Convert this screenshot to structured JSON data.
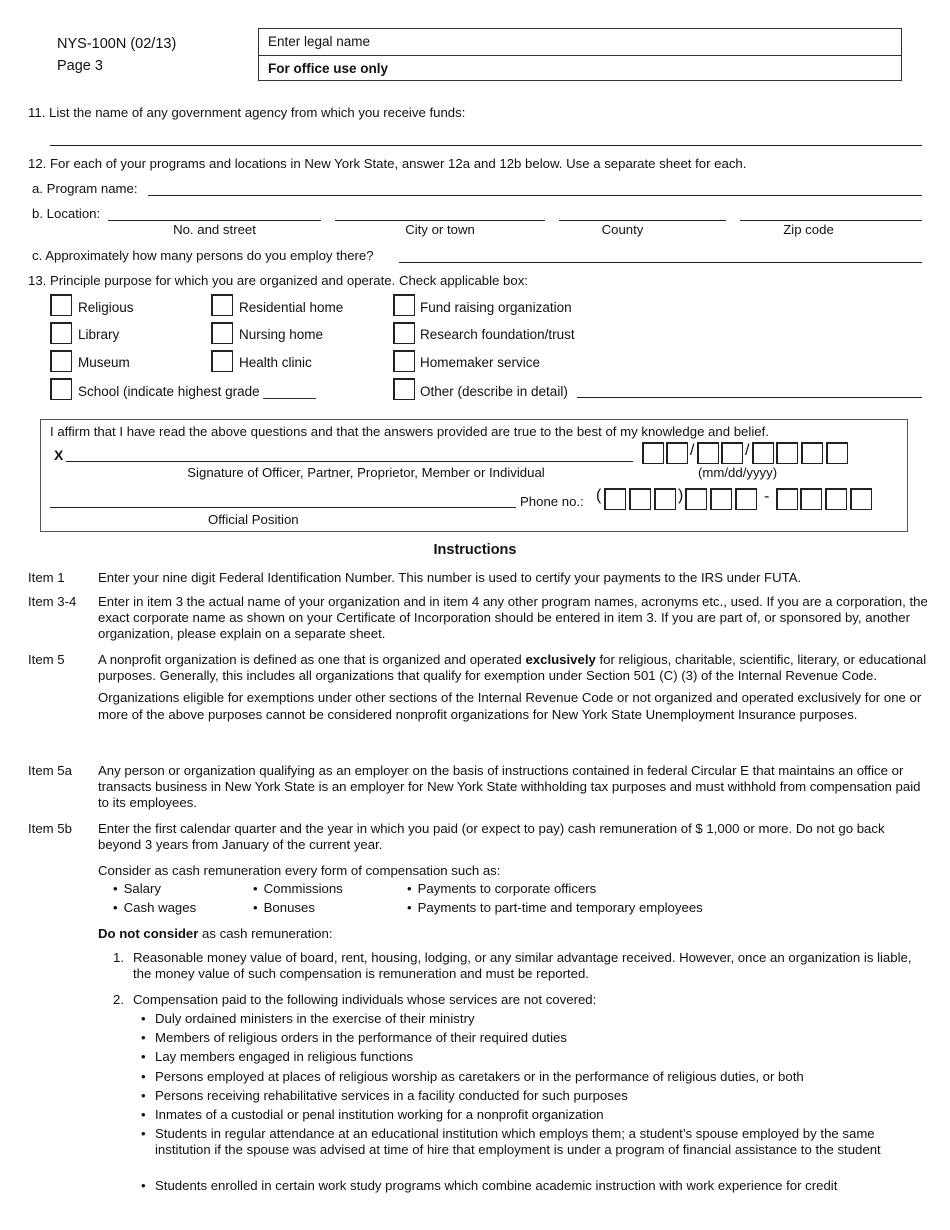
{
  "header": {
    "form_id": "NYS-100N (02/13)",
    "page": "Page 3",
    "legal_name_placeholder": "Enter legal name",
    "office_use": "For office use only"
  },
  "q11": {
    "label": "11. List the name of any government agency from which you receive funds:"
  },
  "q12": {
    "label": "12. For each of your programs and locations in New York State, answer 12a and 12b below.  Use a separate sheet for each.",
    "a_label": "a. Program name:",
    "b_label": "b. Location:",
    "location_fields": [
      "No. and street",
      "City or town",
      "County",
      "Zip code"
    ],
    "c_label": "c. Approximately how many persons do you employ there?"
  },
  "q13": {
    "label": "13. Principle purpose for which you are organized and operate.  Check applicable box:",
    "options": [
      "Religious",
      "Residential home",
      "Fund raising organization",
      "Library",
      "Nursing home",
      "Research foundation/trust",
      "Museum",
      "Health clinic",
      "Homemaker service",
      "School (indicate highest grade _______",
      "Other (describe in detail)"
    ]
  },
  "affirm": {
    "statement": "I affirm that I have read the above questions and that the answers provided are true to the best of my knowledge and belief.",
    "x_mark": "X",
    "signature_caption": "Signature of Officer, Partner, Proprietor, Member or Individual",
    "date_caption": "(mm/dd/yyyy)",
    "date_sep": "/",
    "phone_label": "Phone no.:",
    "phone_open": "(",
    "phone_close": ")",
    "phone_dash": "-",
    "position_caption": "Official Position"
  },
  "instructions": {
    "title": "Instructions",
    "items": [
      {
        "label": "Item 1",
        "paras": [
          "Enter your nine digit Federal Identification Number.  This number is used to certify your payments to the IRS under FUTA."
        ]
      },
      {
        "label": "Item 3-4",
        "paras": [
          "Enter in item 3 the actual name of your organization and in item 4 any other program names, acronyms etc., used.  If you are a corporation, the exact corporate name as shown on your Certificate of Incorporation should be entered in item 3.  If you are part of, or sponsored by, another organization, please explain on a separate sheet."
        ]
      },
      {
        "label": "Item 5",
        "para1_pre": "A nonprofit organization is defined as one that is organized and operated ",
        "para1_bold": "exclusively",
        "para1_post": " for religious, charitable, scientific, literary, or educational purposes.  Generally, this includes all organizations that qualify for exemption under Section 501 (C) (3) of the Internal Revenue Code.",
        "para2": "Organizations eligible for exemptions under other sections of the Internal Revenue Code or not organized and operated exclusively for one or more of the above purposes cannot be considered nonprofit organizations for New York State Unemployment Insurance purposes."
      },
      {
        "label": "Item 5a",
        "paras": [
          "Any person or organization qualifying as an employer on the basis of instructions contained in federal Circular E that maintains an office or transacts business in New York State is an employer for New York State withholding tax purposes and must withhold from compensation paid to its employees."
        ]
      },
      {
        "label": "Item 5b",
        "paras": [
          "Enter the first calendar quarter and the year in which you paid (or expect to pay) cash remuneration of $ 1,000 or more.  Do not go back beyond 3 years from January of the current year.",
          "Consider as cash remuneration every form of compensation such as:"
        ]
      }
    ],
    "consider_bullets": [
      "Salary",
      "Commissions",
      "Payments to corporate officers",
      "Cash wages",
      "Bonuses",
      "Payments to part-time and temporary employees"
    ],
    "do_not_bold": "Do not consider",
    "do_not_rest": " as cash remuneration:",
    "numbered": [
      {
        "n": "1.",
        "text": "Reasonable money value of board, rent, housing, lodging, or any similar advantage received.  However, once an organization is liable, the money value of such compensation is remuneration and must be reported."
      },
      {
        "n": "2.",
        "text": "Compensation paid to the following individuals whose services are not covered:"
      }
    ],
    "not_covered": [
      "Duly ordained ministers in the exercise of their ministry",
      "Members of religious orders in the performance of their required duties",
      "Lay members engaged in religious functions",
      "Persons employed at places of religious worship as caretakers or in the performance of religious duties, or both",
      "Persons receiving rehabilitative services in a facility conducted for such purposes",
      "Inmates of a custodial or penal institution working for a nonprofit organization",
      "Students in regular attendance at an educational institution which employs them; a student’s spouse employed by the same institution if the spouse was advised at time of hire that employment is under a program of financial assistance to the student",
      "Students enrolled in certain work study programs which combine academic instruction with work experience for credit"
    ]
  }
}
